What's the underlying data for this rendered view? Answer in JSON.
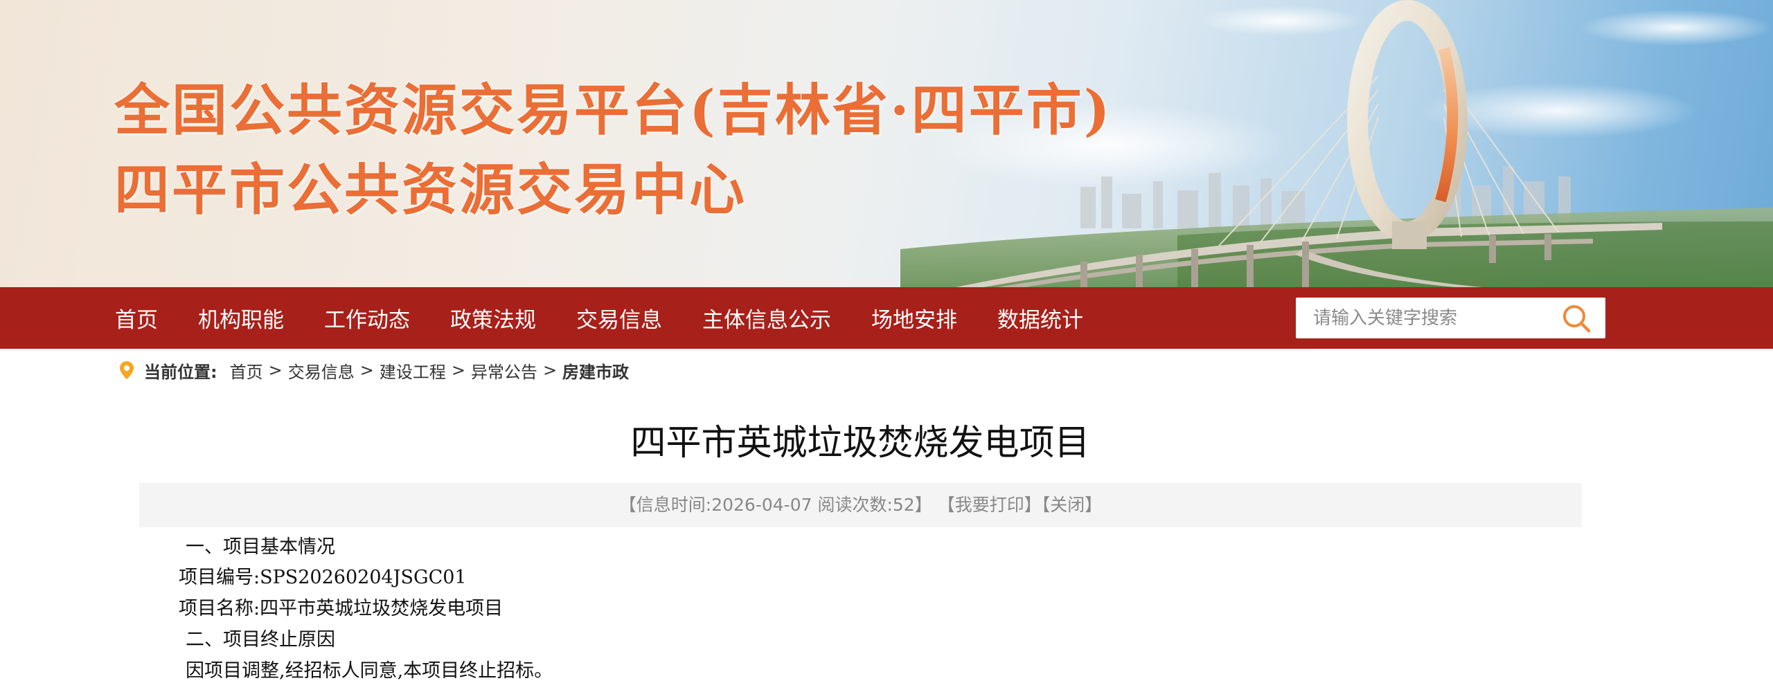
{
  "header": {
    "title_line1": "全国公共资源交易平台(吉林省·四平市)",
    "title_line2": "四平市公共资源交易中心"
  },
  "nav": {
    "items": [
      "首页",
      "机构职能",
      "工作动态",
      "政策法规",
      "交易信息",
      "主体信息公示",
      "场地安排",
      "数据统计"
    ],
    "search_placeholder": "请输入关键字搜索"
  },
  "breadcrumb": {
    "label": "当前位置:",
    "items": [
      "首页",
      "交易信息",
      "建设工程",
      "异常公告"
    ],
    "separator": ">",
    "current": "房建市政"
  },
  "article": {
    "title": "四平市英城垃圾焚烧发电项目",
    "info": {
      "time_prefix": "【信息时间:",
      "date": "2026-04-07",
      "reads_label": "阅读次数:",
      "reads": "52",
      "close_bracket": "】",
      "print": "【我要打印】",
      "close": "【关闭】"
    },
    "paragraphs": [
      "一、项目基本情况",
      "项目编号:SPS20260204JSGC01",
      "项目名称:四平市英城垃圾焚烧发电项目",
      "二、项目终止原因",
      "因项目调整,经招标人同意,本项目终止招标。"
    ]
  },
  "colors": {
    "nav_bg": "#a8201a",
    "title_orange": "#ea6e35",
    "search_icon": "#f0893b",
    "info_bg": "#f4f4f4"
  },
  "icons": [
    "location-pin-icon",
    "search-icon"
  ]
}
